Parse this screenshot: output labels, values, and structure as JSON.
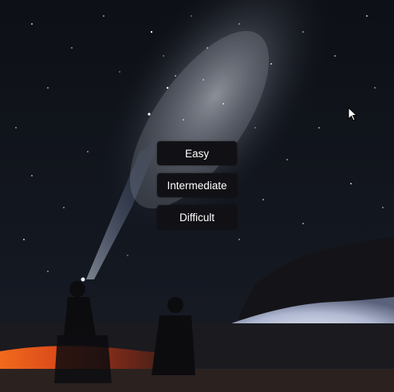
{
  "menu": {
    "items": [
      {
        "label": "Easy"
      },
      {
        "label": "Intermediate"
      },
      {
        "label": "Difficult"
      }
    ]
  },
  "background": {
    "description_icon": "night-sky-milky-way-icon",
    "sky_color": "#0b0e14",
    "glow_color": "#e8622a"
  },
  "cursor": {
    "icon": "mouse-pointer-icon"
  }
}
